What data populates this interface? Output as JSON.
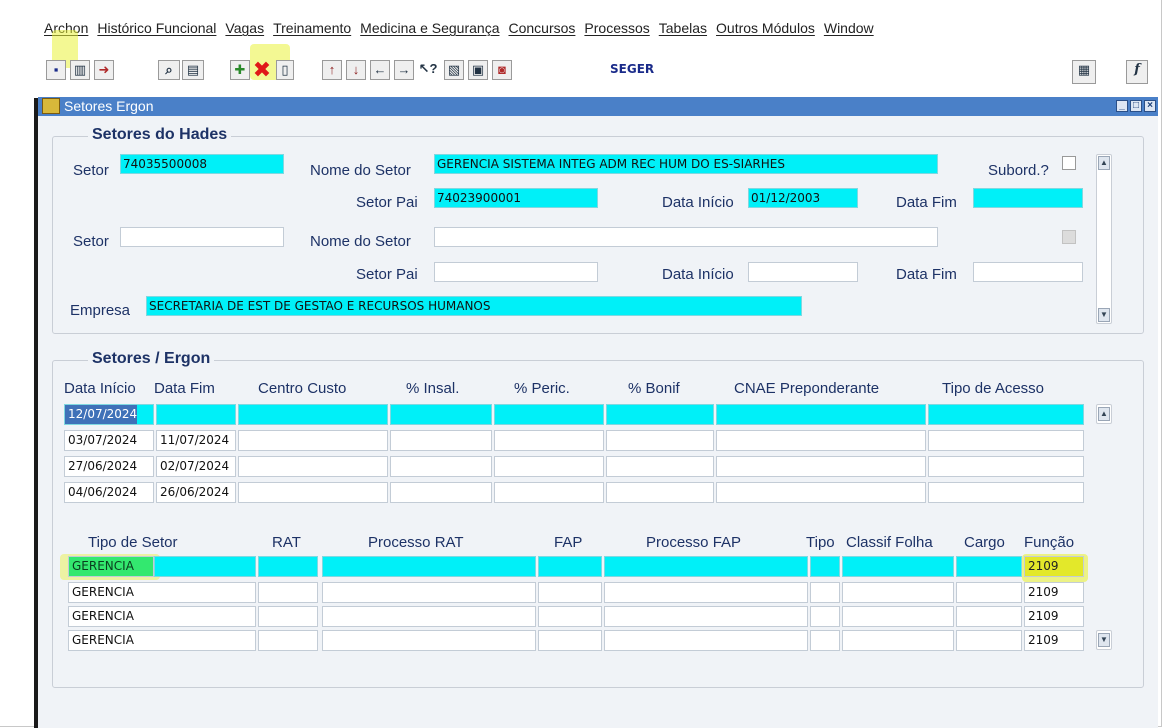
{
  "menu": [
    "Archon",
    "Histórico Funcional",
    "Vagas",
    "Treinamento",
    "Medicina e Segurança",
    "Concursos",
    "Processos",
    "Tabelas",
    "Outros Módulos",
    "Window"
  ],
  "toolbar": {
    "seger_label": "SEGER",
    "icons": [
      "save-icon",
      "trash-icon",
      "exit-icon",
      "search-icon",
      "new-record-icon",
      "delete-record-icon",
      "clear-icon",
      "first-record-icon",
      "last-record-icon",
      "previous-icon",
      "next-icon",
      "help-icon",
      "list-icon",
      "print-icon",
      "emp-icon",
      "module-icon",
      "function-icon"
    ],
    "highlight_color": "#e9f23b",
    "delete_color": "#e01818"
  },
  "window": {
    "title": "Setores Ergon"
  },
  "hades": {
    "group_title": "Setores do Hades",
    "labels": {
      "setor": "Setor",
      "nome_setor": "Nome do Setor",
      "subord": "Subord.?",
      "setor_pai": "Setor Pai",
      "data_inicio": "Data Início",
      "data_fim": "Data Fim",
      "empresa": "Empresa"
    },
    "rec1": {
      "setor": "74035500008",
      "nome_setor": "GERENCIA SISTEMA INTEG ADM REC HUM DO ES-SIARHES",
      "setor_pai": "74023900001",
      "data_inicio": "01/12/2003",
      "data_fim": ""
    },
    "rec2": {
      "setor": "",
      "nome_setor": "",
      "setor_pai": "",
      "data_inicio": "",
      "data_fim": ""
    },
    "empresa": "SECRETARIA DE EST DE GESTAO E RECURSOS HUMANOS"
  },
  "ergon": {
    "group_title": "Setores / Ergon",
    "headers": [
      "Data Início",
      "Data Fim",
      "Centro Custo",
      "% Insal.",
      "% Peric.",
      "% Bonif",
      "CNAE Preponderante",
      "Tipo de Acesso"
    ],
    "rows": [
      [
        "12/07/2024",
        "",
        "",
        "",
        "",
        "",
        "",
        ""
      ],
      [
        "03/07/2024",
        "11/07/2024",
        "",
        "",
        "",
        "",
        "",
        ""
      ],
      [
        "27/06/2024",
        "02/07/2024",
        "",
        "",
        "",
        "",
        "",
        ""
      ],
      [
        "04/06/2024",
        "26/06/2024",
        "",
        "",
        "",
        "",
        "",
        ""
      ]
    ],
    "headers2": [
      "Tipo de Setor",
      "RAT",
      "Processo RAT",
      "FAP",
      "Processo FAP",
      "Tipo",
      "Classif Folha",
      "Cargo",
      "Função"
    ],
    "rows2": [
      [
        "GERENCIA",
        "",
        "",
        "",
        "",
        "",
        "",
        "",
        "2109"
      ],
      [
        "GERENCIA",
        "",
        "",
        "",
        "",
        "",
        "",
        "",
        "2109"
      ],
      [
        "GERENCIA",
        "",
        "",
        "",
        "",
        "",
        "",
        "",
        "2109"
      ],
      [
        "GERENCIA",
        "",
        "",
        "",
        "",
        "",
        "",
        "",
        "2109"
      ]
    ],
    "current_color": "#00f0f8",
    "selected_color": "#3f71b8",
    "annotation_green": "#33e86f",
    "annotation_yellow": "#e3e82a"
  }
}
